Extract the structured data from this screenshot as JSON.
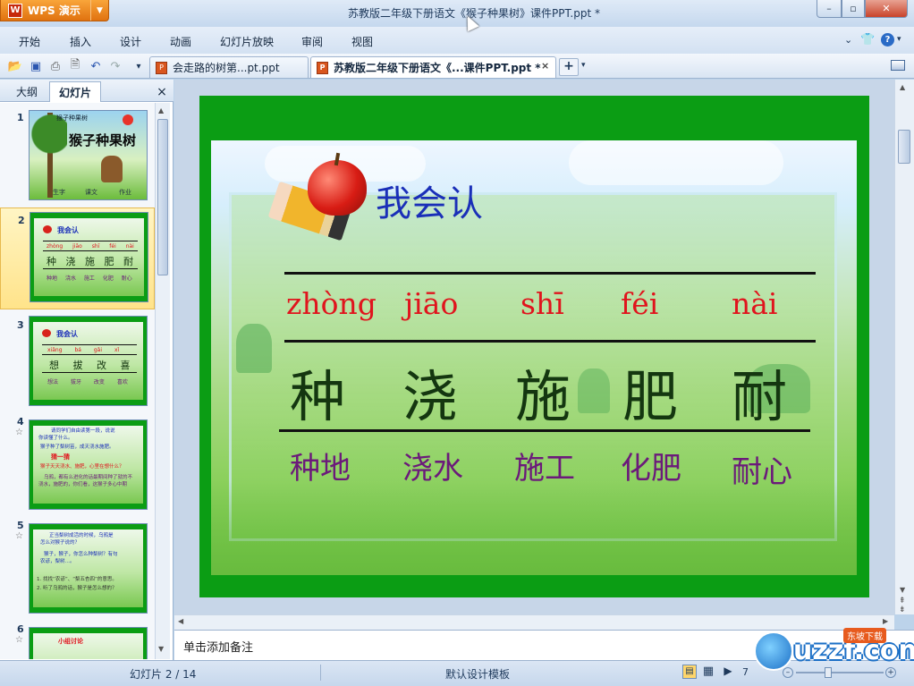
{
  "app": {
    "menu_label": "WPS 演示",
    "logo_glyph": "W",
    "window_title": "苏教版二年级下册语文《猴子种果树》课件PPT.ppt *"
  },
  "menu": [
    "开始",
    "插入",
    "设计",
    "动画",
    "幻灯片放映",
    "审阅",
    "视图"
  ],
  "toolbar": {
    "icons": [
      "open-folder-icon",
      "save-icon",
      "print-icon",
      "print-preview-icon",
      "undo-icon",
      "redo-icon"
    ]
  },
  "tabs": [
    {
      "label": "会走路的树第...pt.ppt",
      "active": false
    },
    {
      "label": "苏教版二年级下册语文《...课件PPT.ppt *",
      "active": true
    }
  ],
  "new_tab_label": "+",
  "panel": {
    "tabs": [
      "大纲",
      "幻灯片"
    ],
    "active_tab": "幻灯片",
    "close_label": "×",
    "slides": [
      {
        "num": "1",
        "star": false,
        "title": "猴子种果树",
        "line": "猴子种果树",
        "labels": [
          "生字",
          "课文",
          "作业"
        ]
      },
      {
        "num": "2",
        "star": false,
        "title": "我会认",
        "pinyin": [
          "zhòng",
          "jiāo",
          "shī",
          "féi",
          "nài"
        ],
        "hanzi": [
          "种",
          "浇",
          "施",
          "肥",
          "耐"
        ],
        "words": [
          "种地",
          "浇水",
          "施工",
          "化肥",
          "耐心"
        ]
      },
      {
        "num": "3",
        "star": false,
        "title": "我会认",
        "pinyin": [
          "xiǎng",
          "bá",
          "gǎi",
          "xǐ"
        ],
        "hanzi": [
          "想",
          "拔",
          "改",
          "喜"
        ],
        "words": [
          "想法",
          "拔牙",
          "改变",
          "喜欢"
        ]
      },
      {
        "num": "4",
        "star": true,
        "lines": [
          "请同学们自由读第一段，说说",
          "你读懂了什么。",
          "猴子种了梨树苗，成天浇水施肥。",
          "猜一猜",
          "猴子天天浇水、施肥，心里在想什么？",
          "乌鸦，都有么进化的话最期间种了就的不",
          "浇水，施肥的，你们看，这猴子多心中期"
        ]
      },
      {
        "num": "5",
        "star": true,
        "lines": [
          "正当梨树成活的时候，乌鸦是",
          "怎么对猴子说的？",
          "猴子，猴子，你怎么种梨树？有句",
          "农谚，梨树…。",
          "1. 找找“农谚”、“梨五杏四”的意思。",
          "2. 听了乌鸦的话，猴子是怎么想的？"
        ]
      },
      {
        "num": "6",
        "star": true,
        "title": "小组讨论"
      }
    ]
  },
  "slide": {
    "title": "我会认",
    "pinyin": [
      "zhòng",
      "jiāo",
      "shī",
      "féi",
      "nài"
    ],
    "hanzi": [
      "种",
      "浇",
      "施",
      "肥",
      "耐"
    ],
    "words": [
      "种地",
      "浇水",
      "施工",
      "化肥",
      "耐心"
    ]
  },
  "notes_placeholder": "单击添加备注",
  "status": {
    "slide_counter": "幻灯片 2 / 14",
    "template": "默认设计模板",
    "zoom": "7"
  },
  "watermark": {
    "text": "uzzf.com",
    "tag": "东坡下载"
  }
}
